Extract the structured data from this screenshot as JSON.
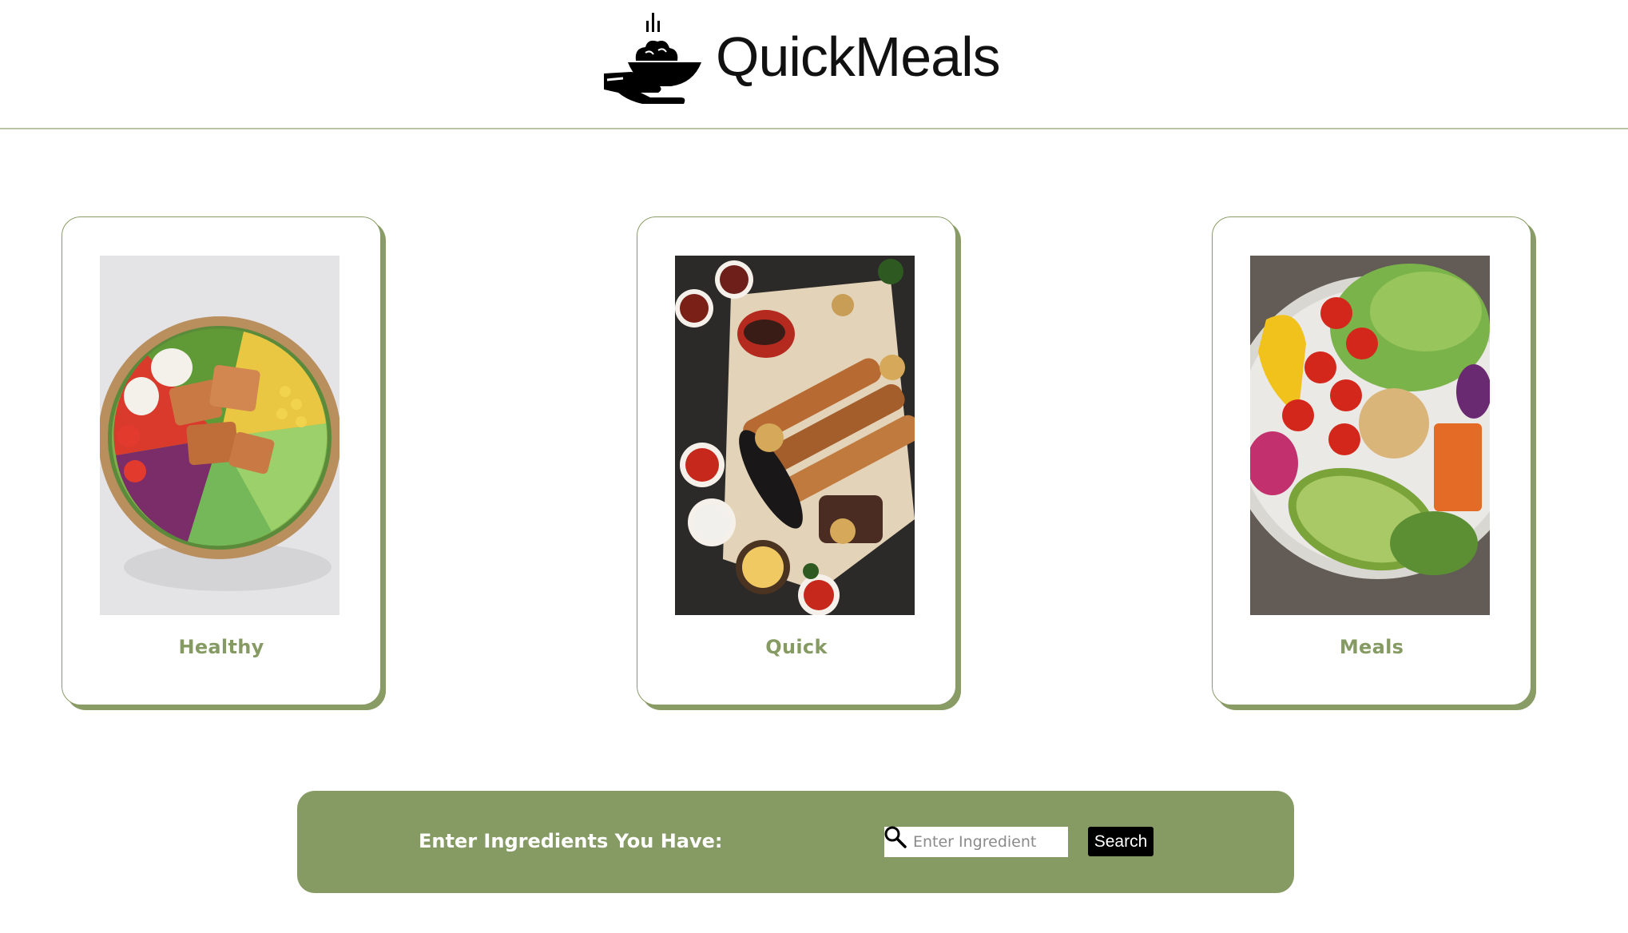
{
  "brand": {
    "name": "QuickMeals",
    "logo_icon": "serving-hand-bowl-icon"
  },
  "cards": [
    {
      "label": "Healthy",
      "image": "salmon-grain-bowl-photo"
    },
    {
      "label": "Quick",
      "image": "grilled-kebab-platter-photo"
    },
    {
      "label": "Meals",
      "image": "avocado-veggie-bowl-photo"
    }
  ],
  "search": {
    "label": "Enter Ingredients You Have:",
    "placeholder": "Enter Ingredient",
    "button_label": "Search",
    "icon": "magnifier-icon"
  },
  "colors": {
    "accent": "#869a63",
    "header_rule": "#b9c4a4",
    "button": "#000000"
  }
}
